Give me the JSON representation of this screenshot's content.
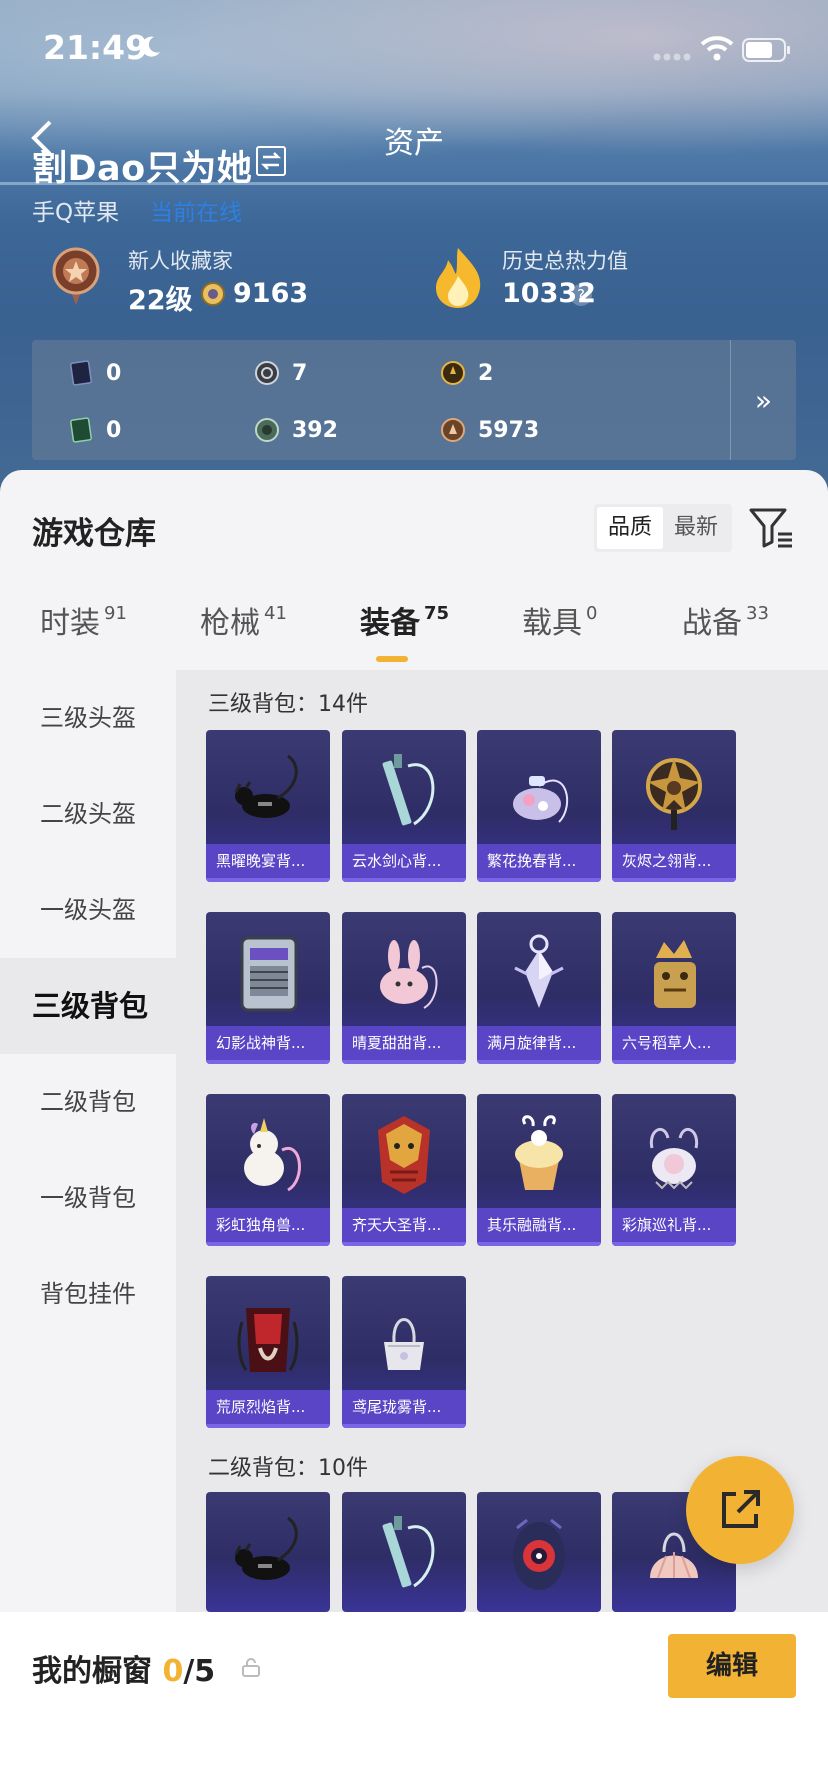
{
  "status_bar": {
    "time": "21:49"
  },
  "header": {
    "title": "资产",
    "player_name": "割Dao只为她",
    "platform": "手Q苹果",
    "online_status": "当前在线",
    "collector_title": "新人收藏家",
    "level": "22级",
    "coins": "9163",
    "heat_title": "历史总热力值",
    "heat_value": "10332",
    "help_label": "?"
  },
  "resources": [
    {
      "icon": "dark-card-icon",
      "value": "0"
    },
    {
      "icon": "silver-token-icon",
      "value": "7"
    },
    {
      "icon": "gold-token-icon",
      "value": "2"
    },
    {
      "icon": "green-card-icon",
      "value": "0"
    },
    {
      "icon": "jade-coin-icon",
      "value": "392"
    },
    {
      "icon": "bronze-coin-icon",
      "value": "5973"
    }
  ],
  "resources_more": "»",
  "warehouse": {
    "title": "游戏仓库",
    "sort_quality": "品质",
    "sort_newest": "最新"
  },
  "tabs": [
    {
      "label": "时装",
      "count": "91"
    },
    {
      "label": "枪械",
      "count": "41"
    },
    {
      "label": "装备",
      "count": "75"
    },
    {
      "label": "载具",
      "count": "0"
    },
    {
      "label": "战备",
      "count": "33"
    }
  ],
  "side_menu": [
    "三级头盔",
    "二级头盔",
    "一级头盔",
    "三级背包",
    "二级背包",
    "一级背包",
    "背包挂件"
  ],
  "groups": [
    {
      "title": "三级背包：14件",
      "items": [
        {
          "name": "黑曜晚宴背...",
          "art": "black-dog"
        },
        {
          "name": "云水剑心背...",
          "art": "sword"
        },
        {
          "name": "繁花挽春背...",
          "art": "flower-bag"
        },
        {
          "name": "灰烬之翎背...",
          "art": "gold-ornament"
        },
        {
          "name": "幻影战神背...",
          "art": "mech-pack"
        },
        {
          "name": "晴夏甜甜背...",
          "art": "pink-bunny"
        },
        {
          "name": "满月旋律背...",
          "art": "moon-crystal"
        },
        {
          "name": "六号稻草人...",
          "art": "scarecrow"
        },
        {
          "name": "彩虹独角兽...",
          "art": "unicorn"
        },
        {
          "name": "齐天大圣背...",
          "art": "monkey-king"
        },
        {
          "name": "其乐融融背...",
          "art": "cupcake"
        },
        {
          "name": "彩旗巡礼背...",
          "art": "lace-bag"
        },
        {
          "name": "荒原烈焰背...",
          "art": "flame-pack"
        },
        {
          "name": "鸢尾珑雾背...",
          "art": "iris-bag"
        }
      ]
    },
    {
      "title": "二级背包：10件",
      "items": [
        {
          "name": "",
          "art": "black-dog"
        },
        {
          "name": "",
          "art": "sword"
        },
        {
          "name": "",
          "art": "red-eye-pack"
        },
        {
          "name": "",
          "art": "shell"
        }
      ]
    }
  ],
  "showcase": {
    "label": "我的橱窗",
    "current": "0",
    "total": "/5"
  },
  "edit_label": "编辑",
  "colors": {
    "accent": "#f2b233",
    "card_label": "#5a45c6",
    "card_bg": "#2e2d66"
  }
}
